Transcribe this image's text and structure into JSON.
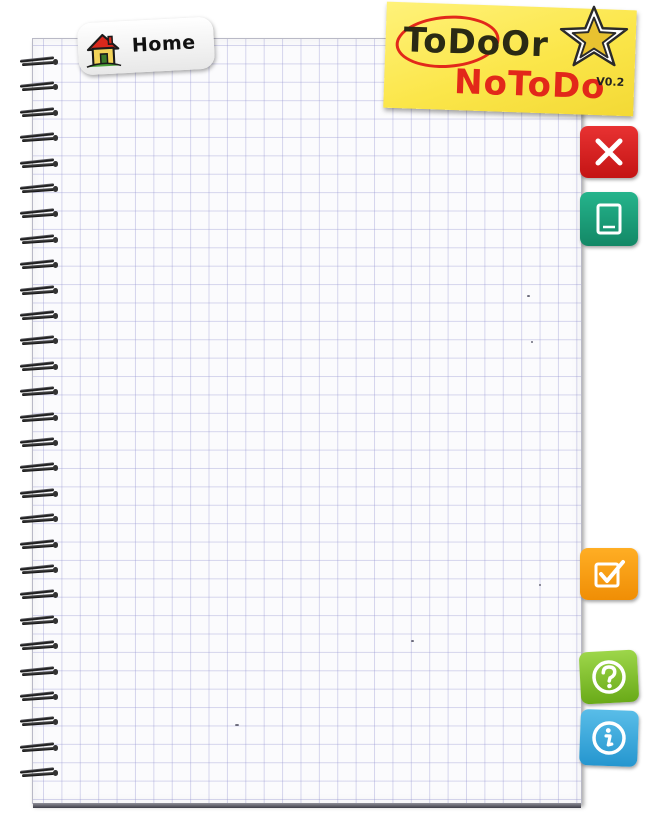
{
  "app": {
    "logo_line1": "ToDoOr",
    "logo_line2": "NoToDo",
    "version": "V0.2"
  },
  "nav": {
    "home_label": "Home",
    "home_icon": "house-icon"
  },
  "side_tabs": [
    {
      "name": "close",
      "icon": "close-icon",
      "color": "#d42222"
    },
    {
      "name": "note",
      "icon": "note-icon",
      "color": "#1c9f78"
    },
    {
      "name": "done",
      "icon": "checkbox-icon",
      "color": "#f79e12"
    },
    {
      "name": "help",
      "icon": "question-icon",
      "color": "#7fc232"
    },
    {
      "name": "info",
      "icon": "info-icon",
      "color": "#3aa8dc"
    }
  ],
  "colors": {
    "sticky_note": "#fbe64a",
    "logo_red": "#e2281a",
    "grid_line": "#9696d2"
  }
}
